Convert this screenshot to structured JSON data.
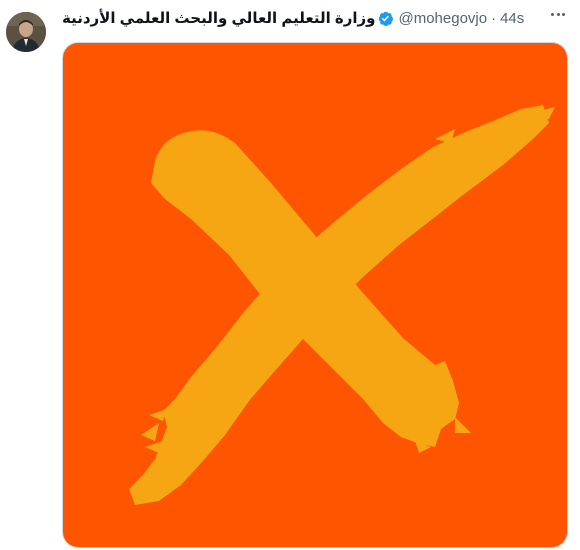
{
  "tweet": {
    "display_name": "وزارة التعليم العالي والبحث العلمي الأردنية",
    "verified": true,
    "handle": "@mohegovjo",
    "separator": "·",
    "time": "44s",
    "more_icon": "more-horizontal-icon",
    "media": {
      "icon": "big-x-mark",
      "background_color": "#FF5500",
      "mark_color": "#F5A612"
    }
  },
  "colors": {
    "name_text": "#0f1419",
    "secondary_text": "#536471",
    "verified_badge": "#1d9bf0"
  }
}
